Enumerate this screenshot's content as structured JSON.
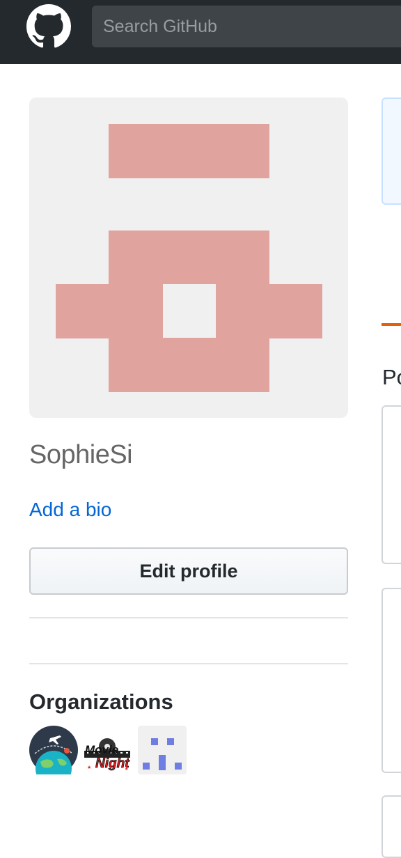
{
  "header": {
    "logo_icon": "github-octocat-icon",
    "search_placeholder": "Search GitHub"
  },
  "profile": {
    "avatar_icon": "identicon-avatar",
    "avatar_color": "#e0a39e",
    "username": "SophieSi",
    "add_bio_label": "Add a bio",
    "edit_profile_label": "Edit profile"
  },
  "organizations": {
    "heading": "Organizations",
    "items": [
      {
        "icon": "travel-globe-org-icon"
      },
      {
        "icon": "movie-night-org-icon",
        "logo_text": "Movie Night"
      },
      {
        "icon": "identicon-org-icon"
      }
    ]
  },
  "right_column": {
    "heading_fragment": "Po"
  },
  "colors": {
    "topbar": "#24292e",
    "link": "#0366d6",
    "accent_underline": "#e36209"
  }
}
